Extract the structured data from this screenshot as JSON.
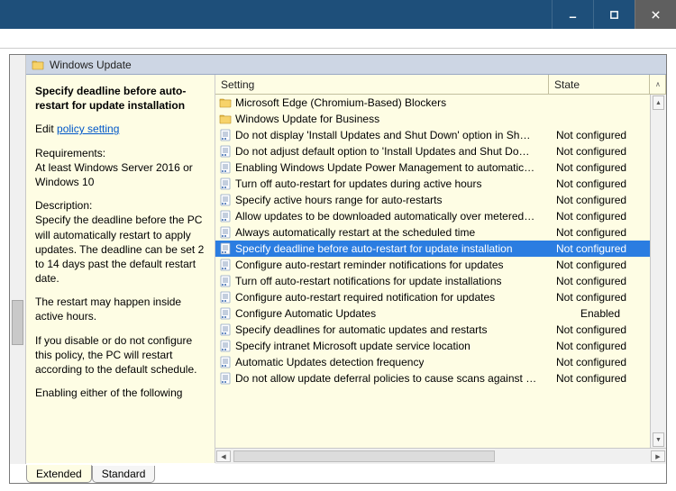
{
  "category": {
    "label": "Windows Update"
  },
  "desc": {
    "title": "Specify deadline before auto-restart for update installation",
    "edit_prefix": "Edit ",
    "edit_link": "policy setting ",
    "req_label": "Requirements:",
    "req_text": "At least Windows Server 2016 or Windows 10",
    "desc_label": "Description:",
    "desc_text": "Specify the deadline before the PC will automatically restart to apply updates. The deadline can be set 2 to 14 days past the default restart date.",
    "p2": "The restart may happen inside active hours.",
    "p3": "If you disable or do not configure this policy, the PC will restart according to the default schedule.",
    "p4": "Enabling either of the following"
  },
  "columns": {
    "setting": "Setting",
    "state": "State"
  },
  "rows": [
    {
      "type": "folder",
      "label": "Microsoft Edge (Chromium-Based) Blockers",
      "state": ""
    },
    {
      "type": "folder",
      "label": "Windows Update for Business",
      "state": ""
    },
    {
      "type": "setting",
      "label": "Do not display 'Install Updates and Shut Down' option in Sh…",
      "state": "Not configured"
    },
    {
      "type": "setting",
      "label": "Do not adjust default option to 'Install Updates and Shut Do…",
      "state": "Not configured"
    },
    {
      "type": "setting",
      "label": "Enabling Windows Update Power Management to automatic…",
      "state": "Not configured"
    },
    {
      "type": "setting",
      "label": "Turn off auto-restart for updates during active hours",
      "state": "Not configured"
    },
    {
      "type": "setting",
      "label": "Specify active hours range for auto-restarts",
      "state": "Not configured"
    },
    {
      "type": "setting",
      "label": "Allow updates to be downloaded automatically over metered…",
      "state": "Not configured"
    },
    {
      "type": "setting",
      "label": "Always automatically restart at the scheduled time",
      "state": "Not configured"
    },
    {
      "type": "setting",
      "label": "Specify deadline before auto-restart for update installation",
      "state": "Not configured",
      "selected": true
    },
    {
      "type": "setting",
      "label": "Configure auto-restart reminder notifications for updates",
      "state": "Not configured"
    },
    {
      "type": "setting",
      "label": "Turn off auto-restart notifications for update installations",
      "state": "Not configured"
    },
    {
      "type": "setting",
      "label": "Configure auto-restart required notification for updates",
      "state": "Not configured"
    },
    {
      "type": "setting",
      "label": "Configure Automatic Updates",
      "state": "Enabled",
      "enabled": true
    },
    {
      "type": "setting",
      "label": "Specify deadlines for automatic updates and restarts",
      "state": "Not configured"
    },
    {
      "type": "setting",
      "label": "Specify intranet Microsoft update service location",
      "state": "Not configured"
    },
    {
      "type": "setting",
      "label": "Automatic Updates detection frequency",
      "state": "Not configured"
    },
    {
      "type": "setting",
      "label": "Do not allow update deferral policies to cause scans against …",
      "state": "Not configured"
    }
  ],
  "tabs": {
    "extended": "Extended",
    "standard": "Standard"
  }
}
